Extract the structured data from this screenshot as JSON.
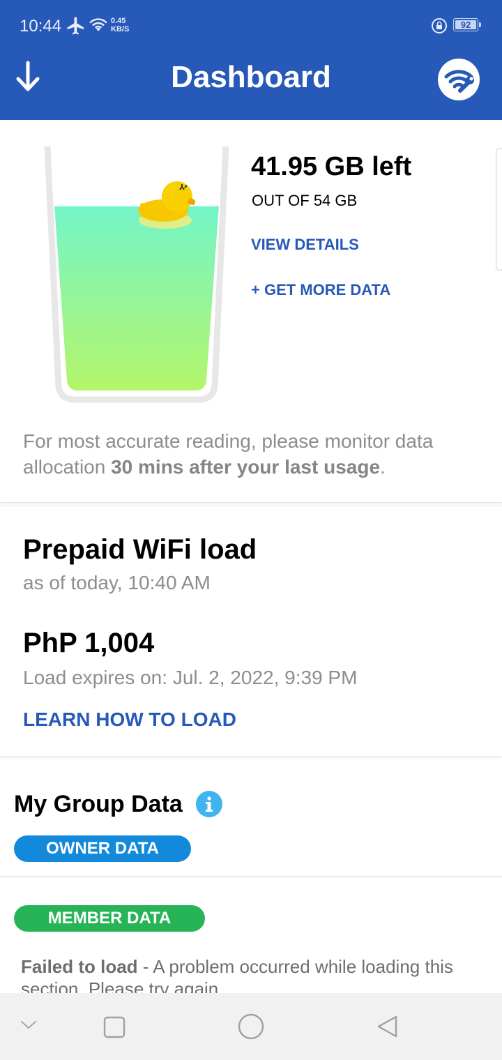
{
  "status_bar": {
    "time": "10:44",
    "net_speed_value": "0.45",
    "net_speed_unit": "KB/S",
    "battery": "92"
  },
  "app_bar": {
    "title": "Dashboard"
  },
  "data_usage": {
    "remaining": "41.95 GB left",
    "total": "OUT OF 54 GB",
    "remaining_fraction": 0.777,
    "view_details_label": "VIEW DETAILS",
    "get_more_label": "+ GET MORE DATA",
    "note_prefix": "For most accurate reading, please monitor data allocation ",
    "note_bold": "30 mins after your last usage",
    "note_suffix": "."
  },
  "prepaid": {
    "title": "Prepaid WiFi load",
    "as_of": "as of today, 10:40 AM",
    "balance": "PhP 1,004",
    "expiry": "Load expires on: Jul. 2, 2022, 9:39 PM",
    "learn_label": "LEARN HOW TO LOAD"
  },
  "group_data": {
    "title": "My Group Data",
    "owner_label": "OWNER DATA",
    "member_label": "MEMBER DATA",
    "fail_bold": "Failed to load",
    "fail_text": " - A problem occurred while loading this section. Please try again."
  },
  "colors": {
    "brand_blue": "#2759b8",
    "owner_blue": "#1389dc",
    "member_green": "#27b456",
    "info_blue": "#3fb4ef"
  }
}
